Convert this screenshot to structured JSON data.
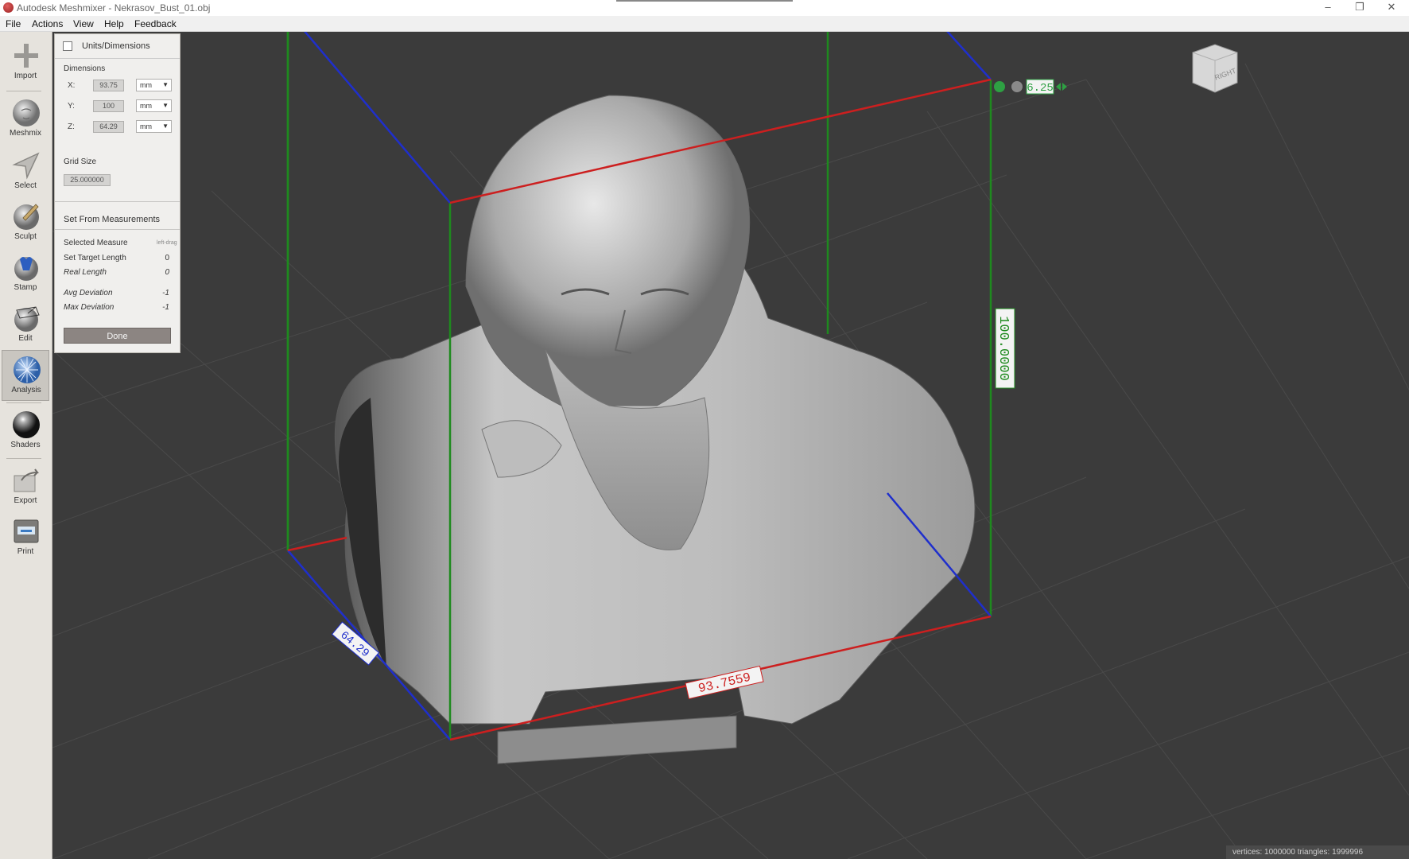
{
  "window": {
    "title": "Autodesk Meshmixer - Nekrasov_Bust_01.obj",
    "controls": {
      "minimize": "–",
      "restore": "❐",
      "close": "✕"
    }
  },
  "menu": {
    "items": [
      "File",
      "Actions",
      "View",
      "Help",
      "Feedback"
    ]
  },
  "toolbar": {
    "tools": [
      {
        "label": "Import",
        "icon": "plus-icon"
      },
      {
        "label": "Meshmix",
        "icon": "face-sphere-icon"
      },
      {
        "label": "Select",
        "icon": "arrow-cursor-icon"
      },
      {
        "label": "Sculpt",
        "icon": "brush-sphere-icon"
      },
      {
        "label": "Stamp",
        "icon": "stamp-icon"
      },
      {
        "label": "Edit",
        "icon": "wireframe-sphere-icon"
      },
      {
        "label": "Analysis",
        "icon": "analysis-icon",
        "active": true
      },
      {
        "label": "Shaders",
        "icon": "shader-ball-icon"
      },
      {
        "label": "Export",
        "icon": "export-icon"
      },
      {
        "label": "Print",
        "icon": "printer-icon"
      }
    ]
  },
  "panel": {
    "title": "Units/Dimensions",
    "dimensions_label": "Dimensions",
    "dims": [
      {
        "axis": "X:",
        "value": "93.75",
        "unit": "mm"
      },
      {
        "axis": "Y:",
        "value": "100",
        "unit": "mm"
      },
      {
        "axis": "Z:",
        "value": "64.29",
        "unit": "mm"
      }
    ],
    "grid_size_label": "Grid Size",
    "grid_size_value": "25.000000",
    "set_from_label": "Set From Measurements",
    "selected_measure": "Selected Measure",
    "selected_hint": "left-drag",
    "target_length": {
      "label": "Set Target Length",
      "value": "0"
    },
    "real_length": {
      "label": "Real Length",
      "value": "0"
    },
    "avg_deviation": {
      "label": "Avg Deviation",
      "value": "-1"
    },
    "max_deviation": {
      "label": "Max Deviation",
      "value": "-1"
    },
    "done_label": "Done"
  },
  "viewport": {
    "labels": {
      "width": "93.7559",
      "height": "100.0000",
      "depth": "64.29",
      "grid_step": "6.25"
    },
    "gizmo_icons": [
      "green-s-icon",
      "grey-a-icon",
      "arrows-icon"
    ],
    "view_cube": "RIGHT",
    "status": "vertices: 1000000 triangles: 1999996",
    "colors": {
      "x_axis": "#cc1f1f",
      "y_axis": "#1e8a1e",
      "z_axis": "#1f2fcc",
      "background": "#3b3b3b"
    }
  }
}
